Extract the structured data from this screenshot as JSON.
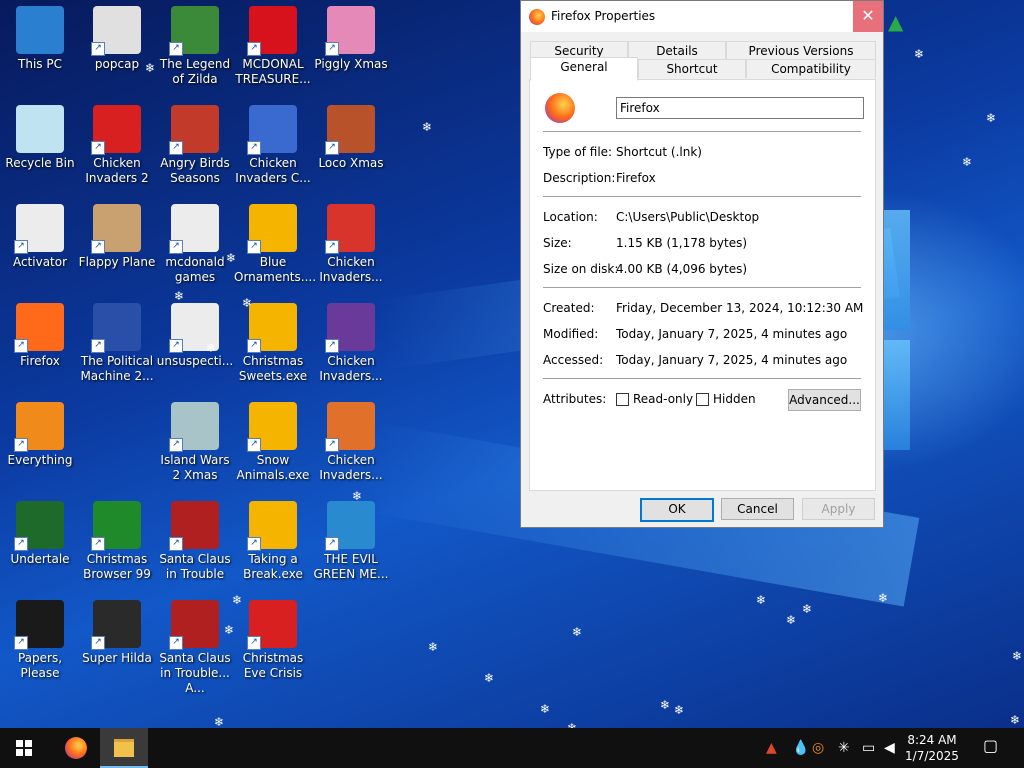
{
  "desktop": {
    "icons": [
      {
        "label": "This PC",
        "color": "#2a7fd0"
      },
      {
        "label": "popcap",
        "color": "#e0e0e0"
      },
      {
        "label": "The Legend of Zilda",
        "color": "#3a8a3a"
      },
      {
        "label": "MCDONAL TREASURE...",
        "color": "#d8121c"
      },
      {
        "label": "Piggly Xmas",
        "color": "#e58ab8"
      },
      {
        "label": "Recycle Bin",
        "color": "#bfe3f0"
      },
      {
        "label": "Chicken Invaders 2",
        "color": "#d82020"
      },
      {
        "label": "Angry Birds Seasons",
        "color": "#c23a2a"
      },
      {
        "label": "Chicken Invaders C...",
        "color": "#3a6ad0"
      },
      {
        "label": "Loco Xmas",
        "color": "#b8522a"
      },
      {
        "label": "Activator",
        "color": "#ececec"
      },
      {
        "label": "Flappy Plane",
        "color": "#c9a070"
      },
      {
        "label": "mcdonald games",
        "color": "#ececec"
      },
      {
        "label": "Blue Ornaments....",
        "color": "#f4b400"
      },
      {
        "label": "Chicken Invaders...",
        "color": "#d9342b"
      },
      {
        "label": "Firefox",
        "color": "#ff6a1a"
      },
      {
        "label": "The Political Machine 2...",
        "color": "#2a4fa8"
      },
      {
        "label": "unsuspecti...",
        "color": "#ececec"
      },
      {
        "label": "Christmas Sweets.exe",
        "color": "#f4b400"
      },
      {
        "label": "Chicken Invaders...",
        "color": "#6a3a9a"
      },
      {
        "label": "Everything",
        "color": "#f08a1a"
      },
      {
        "label": "Island Wars 2 Xmas",
        "color": "#a9c4c8"
      },
      {
        "label": "Snow Animals.exe",
        "color": "#f4b400"
      },
      {
        "label": "Chicken Invaders...",
        "color": "#e0702a"
      },
      {
        "label": "Undertale",
        "color": "#1e6a2a"
      },
      {
        "label": "Christmas Browser 99",
        "color": "#1e8a2a"
      },
      {
        "label": "Santa Claus in Trouble",
        "color": "#b02020"
      },
      {
        "label": "Taking a Break.exe",
        "color": "#f4b400"
      },
      {
        "label": "THE EVIL GREEN ME...",
        "color": "#2a8ad0"
      },
      {
        "label": "Papers, Please",
        "color": "#1a1a1a"
      },
      {
        "label": "Super Hilda",
        "color": "#2a2a2a"
      },
      {
        "label": "Santa Claus in Trouble... A...",
        "color": "#b02020"
      },
      {
        "label": "Christmas Eve Crisis",
        "color": "#d82020"
      }
    ]
  },
  "dialog": {
    "title": "Firefox Properties",
    "close_glyph": "✕",
    "tabs_top": [
      "Security",
      "Details",
      "Previous Versions"
    ],
    "tabs_bottom": [
      "General",
      "Shortcut",
      "Compatibility"
    ],
    "name_value": "Firefox",
    "type_label": "Type of file:",
    "type_value": "Shortcut (.lnk)",
    "desc_label": "Description:",
    "desc_value": "Firefox",
    "location_label": "Location:",
    "location_value": "C:\\Users\\Public\\Desktop",
    "size_label": "Size:",
    "size_value": "1.15 KB (1,178 bytes)",
    "sizeondisk_label": "Size on disk:",
    "sizeondisk_value": "4.00 KB (4,096 bytes)",
    "created_label": "Created:",
    "created_value": "Friday, December 13, 2024, 10:12:30 AM",
    "modified_label": "Modified:",
    "modified_value": "Today, January 7, 2025, 4 minutes ago",
    "accessed_label": "Accessed:",
    "accessed_value": "Today, January 7, 2025, 4 minutes ago",
    "attributes_label": "Attributes:",
    "readonly_label": "Read-only",
    "hidden_label": "Hidden",
    "advanced_label": "Advanced...",
    "ok_label": "OK",
    "cancel_label": "Cancel",
    "apply_label": "Apply"
  },
  "taskbar": {
    "time": "8:24 AM",
    "date": "1/7/2025"
  },
  "colors": {
    "accent": "#0078d7",
    "close_hover": "#e8707a"
  }
}
